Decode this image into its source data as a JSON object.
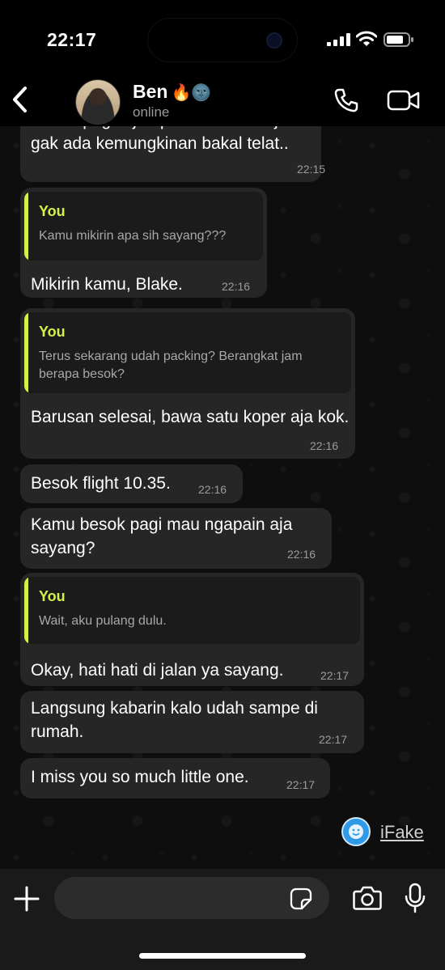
{
  "status_bar": {
    "time": "22:17"
  },
  "header": {
    "contact_name": "Ben",
    "contact_emoji": "🔥🌚",
    "status": "online"
  },
  "messages": [
    {
      "text": "Besok pagi dijemput James kok jadi gak ada kemungkinan bakal telat..",
      "time": "22:15"
    },
    {
      "quote_author": "You",
      "quote_text": "Kamu mikirin apa sih sayang???",
      "text": "Mikirin kamu, Blake.",
      "time": "22:16"
    },
    {
      "quote_author": "You",
      "quote_text": "Terus sekarang udah packing? Berangkat jam berapa besok?",
      "text": "Barusan selesai, bawa satu koper aja kok.",
      "time": "22:16"
    },
    {
      "text": "Besok flight 10.35.",
      "time": "22:16"
    },
    {
      "text": "Kamu besok pagi mau ngapain aja sayang?",
      "time": "22:16"
    },
    {
      "quote_author": "You",
      "quote_text": "Wait, aku pulang dulu.",
      "text": "Okay, hati hati di jalan ya sayang.",
      "time": "22:17"
    },
    {
      "text": "Langsung kabarin kalo udah sampe di rumah.",
      "time": "22:17"
    },
    {
      "text": "I miss you so much little one.",
      "time": "22:17"
    }
  ],
  "watermark": {
    "text": "iFake"
  },
  "input": {
    "placeholder": ""
  },
  "icons": [
    "back-icon",
    "call-icon",
    "video-icon",
    "plus-icon",
    "sticker-icon",
    "camera-icon",
    "mic-icon"
  ],
  "colors": {
    "bubble": "#262626",
    "quote_accent": "#d6f04a",
    "background": "#0e0e0e"
  }
}
